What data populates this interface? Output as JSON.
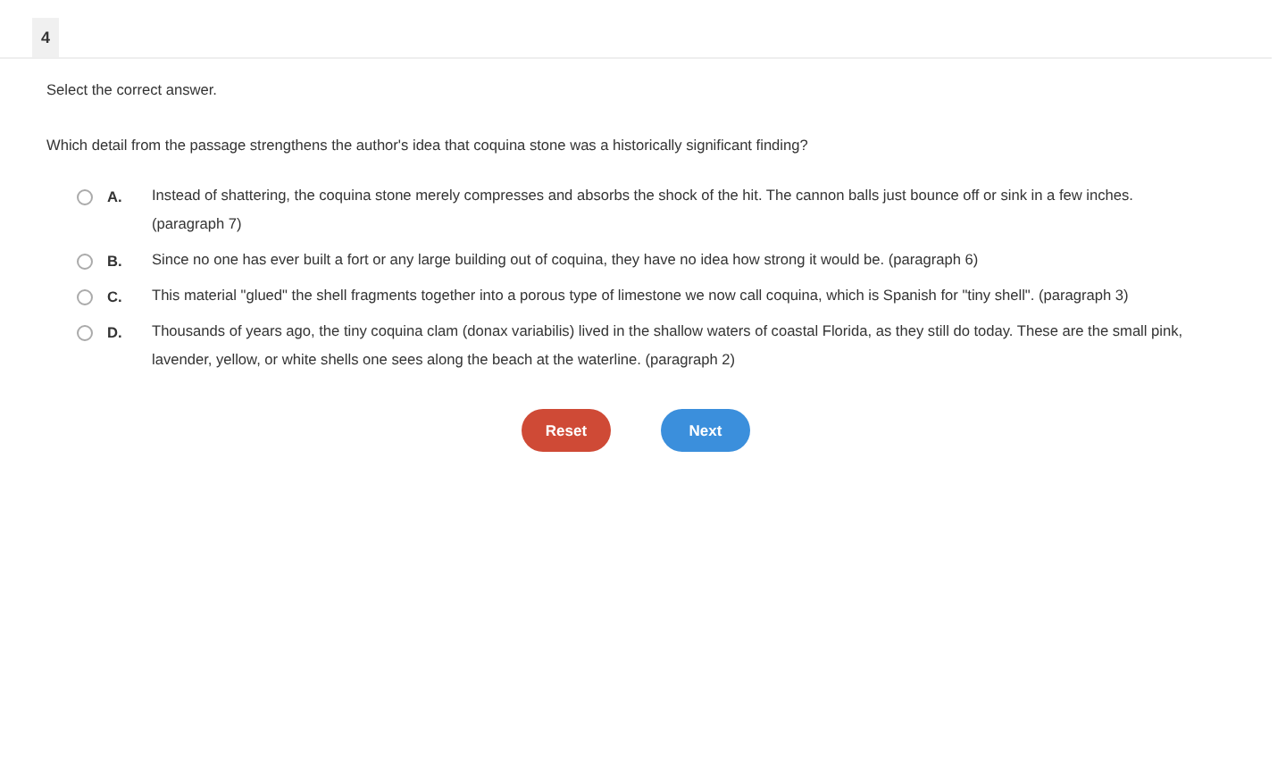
{
  "question_number": "4",
  "instruction": "Select the correct answer.",
  "question": "Which detail from the passage strengthens the author's idea that coquina stone was a historically significant finding?",
  "options": [
    {
      "letter": "A.",
      "text": "Instead of shattering, the coquina stone merely compresses and absorbs the shock of the hit. The cannon balls just bounce off or sink in a few inches. (paragraph 7)",
      "selected": false
    },
    {
      "letter": "B.",
      "text": "Since no one has ever built a fort or any large building out of coquina, they have no idea how strong it would be. (paragraph 6)",
      "selected": false
    },
    {
      "letter": "C.",
      "text": "This material \"glued\" the shell fragments together into a porous type of limestone we now call coquina, which is Spanish for \"tiny shell\". (paragraph 3)",
      "selected": false
    },
    {
      "letter": "D.",
      "text": "Thousands of years ago, the tiny coquina clam (donax variabilis) lived in the shallow waters of coastal Florida, as they still do today. These are the small pink, lavender, yellow, or white shells one sees along the beach at the waterline. (paragraph 2)",
      "selected": false
    }
  ],
  "buttons": [
    {
      "kind": "reset",
      "label": "Reset"
    },
    {
      "kind": "next",
      "label": "Next"
    }
  ]
}
